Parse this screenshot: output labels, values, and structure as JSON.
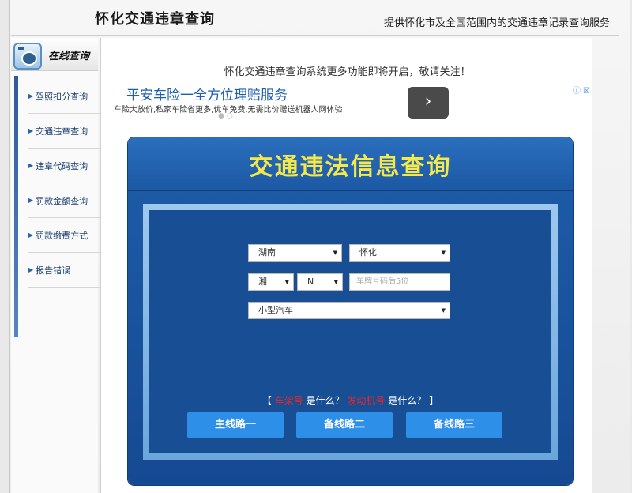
{
  "header": {
    "title": "怀化交通违章查询",
    "tagline": "提供怀化市及全国范围内的交通违章记录查询服务"
  },
  "sidebar": {
    "title": "在线查询",
    "items": [
      {
        "label": "驾照扣分查询"
      },
      {
        "label": "交通违章查询"
      },
      {
        "label": "违章代码查询"
      },
      {
        "label": "罚款金额查询"
      },
      {
        "label": "罚款缴费方式"
      },
      {
        "label": "报告错误"
      }
    ]
  },
  "notice": "怀化交通违章查询系统更多功能即将开启，敬请关注！",
  "ad": {
    "title": "平安车险一全方位理赔服务",
    "description": "车险大放价,私家车险省更多,优车免费,无需比价赠送机器人网体验",
    "go_label": "›",
    "info_label": "ⓘ ☒"
  },
  "form": {
    "title": "交通违法信息查询",
    "province_select": "湖南",
    "city_select": "怀化",
    "plate_prefix": "湘",
    "plate_letter": "N",
    "plate_placeholder": "车牌号码后5位",
    "vehicle_type": "小型汽车",
    "help_open": "【",
    "help_link1": "车架号",
    "help_text1": "是什么？",
    "help_link2": "发动机号",
    "help_text2": "是什么？",
    "help_close": "】",
    "buttons": [
      {
        "label": "主线路一"
      },
      {
        "label": "备线路二"
      },
      {
        "label": "备线路三"
      }
    ]
  }
}
